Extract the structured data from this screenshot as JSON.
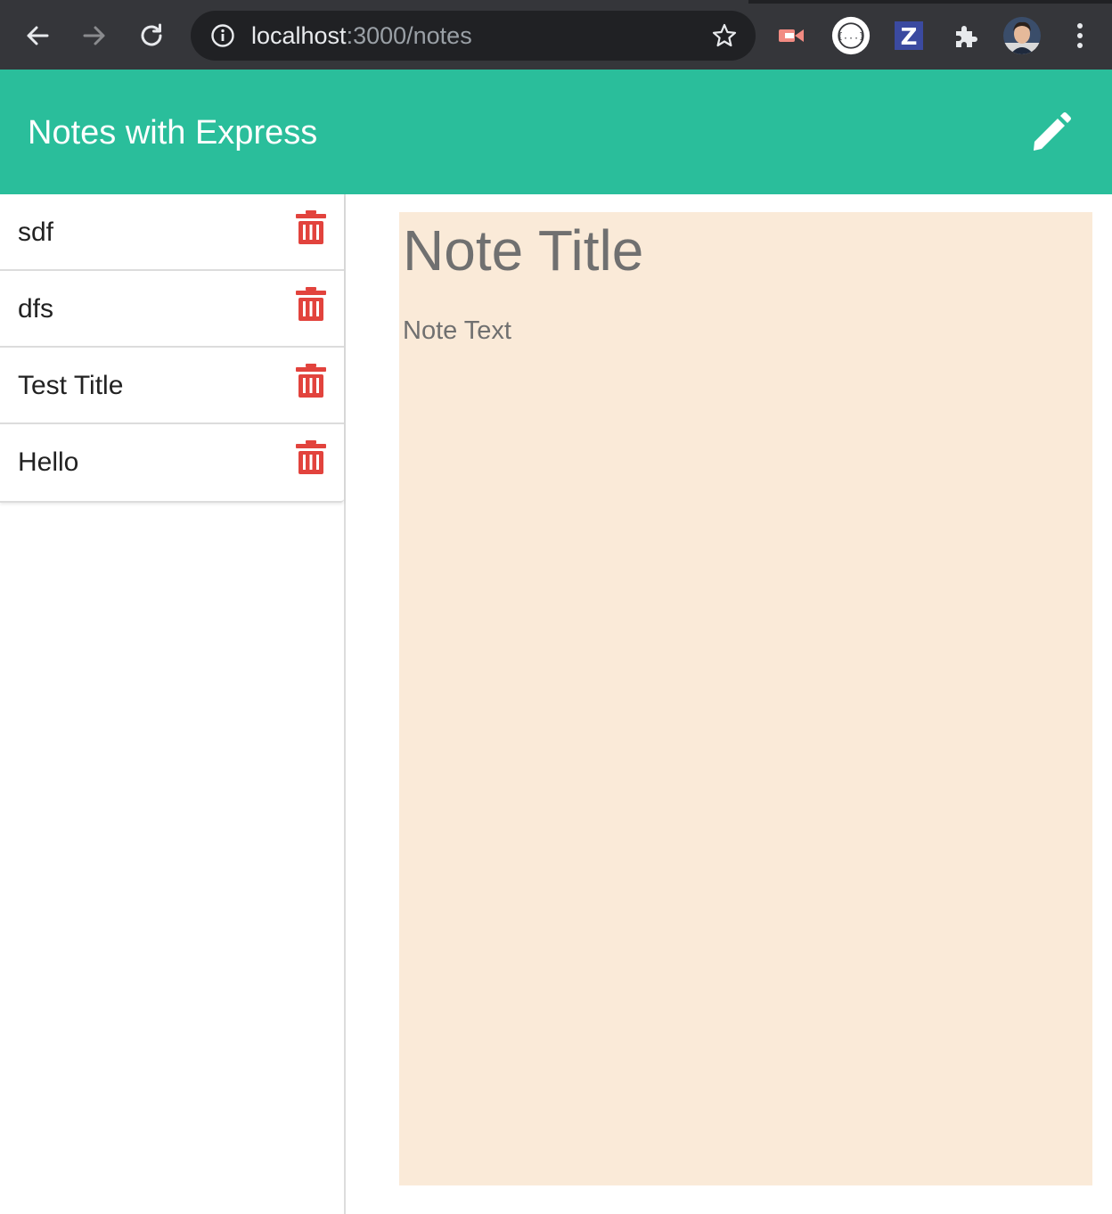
{
  "browser": {
    "url_host": "localhost",
    "url_path": ":3000/notes",
    "icons": {
      "back": "arrow-left-icon",
      "forward": "arrow-right-icon",
      "reload": "reload-icon",
      "site_info": "info-icon",
      "bookmark": "star-icon",
      "extensions": [
        "video-extension-icon",
        "json-extension-icon",
        "z-extension-icon",
        "puzzle-icon"
      ],
      "profile": "avatar",
      "menu": "kebab-menu-icon"
    }
  },
  "header": {
    "title": "Notes with Express",
    "new_note_icon": "pencil-icon",
    "background": "#2abe9b"
  },
  "sidebar": {
    "notes": [
      {
        "title": "sdf"
      },
      {
        "title": "dfs"
      },
      {
        "title": "Test Title"
      },
      {
        "title": "Hello"
      }
    ],
    "delete_icon": "trash-icon",
    "delete_color": "#e2433d"
  },
  "editor": {
    "title_placeholder": "Note Title",
    "text_placeholder": "Note Text",
    "background": "#faead8"
  }
}
